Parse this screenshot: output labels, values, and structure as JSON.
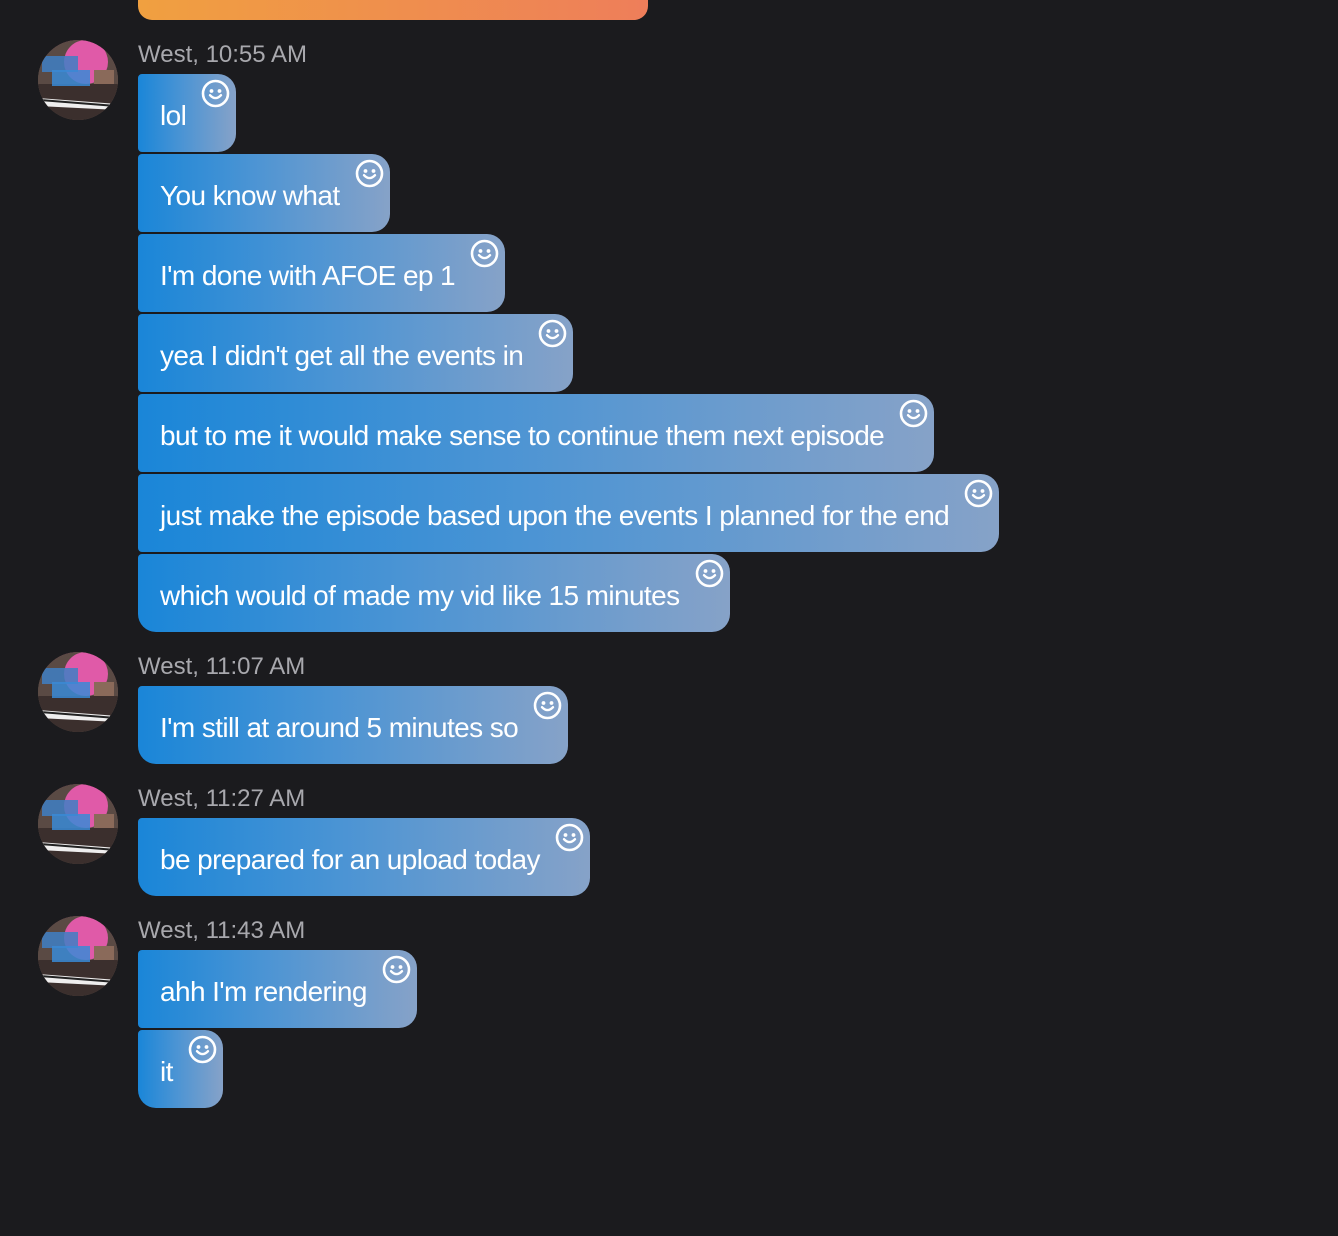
{
  "theme": {
    "background": "#1b1b1e",
    "bubble_gradient": [
      "#1a86d8",
      "#86a2c8"
    ],
    "previous_bubble_gradient": [
      "#f0a040",
      "#ee7e5a"
    ],
    "timestamp_color": "#a8a8ad"
  },
  "groups": [
    {
      "sender": "West",
      "time": "West, 10:55 AM",
      "avatar_icon": "avatar-image",
      "messages": [
        "lol",
        "You know what",
        "I'm done with AFOE ep 1",
        "yea I didn't get all the events in",
        "but to me it would make sense to continue them next episode",
        "just make the episode based upon the events I planned for the end",
        "which would of made my vid like 15 minutes"
      ]
    },
    {
      "sender": "West",
      "time": "West, 11:07 AM",
      "avatar_icon": "avatar-image",
      "messages": [
        "I'm still at around 5 minutes so"
      ]
    },
    {
      "sender": "West",
      "time": "West, 11:27 AM",
      "avatar_icon": "avatar-image",
      "messages": [
        "be prepared for an upload today"
      ]
    },
    {
      "sender": "West",
      "time": "West, 11:43 AM",
      "avatar_icon": "avatar-image",
      "messages": [
        "ahh I'm rendering",
        "it"
      ]
    }
  ],
  "reaction_icon": "smiley-reaction-icon"
}
